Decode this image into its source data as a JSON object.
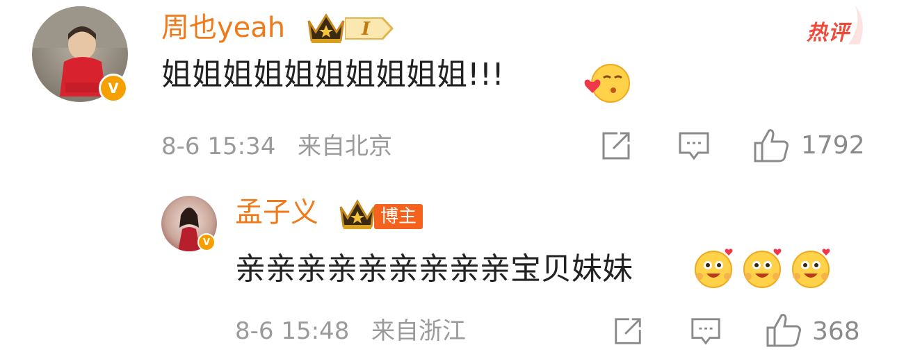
{
  "comment": {
    "username": "周也yeah",
    "level_badge": "I",
    "hot_label": "热评",
    "text": "姐姐姐姐姐姐姐姐姐姐!!!",
    "emoji": "kiss-heart-emoji",
    "timestamp": "8-6 15:34",
    "location": "来自北京",
    "like_count": "1792"
  },
  "reply": {
    "username": "孟子义",
    "tag": "博主",
    "text": "亲亲亲亲亲亲亲亲亲宝贝妹妹",
    "emojis": [
      "love-eyes-emoji",
      "love-eyes-emoji",
      "love-eyes-emoji"
    ],
    "timestamp": "8-6 15:48",
    "location": "来自浙江",
    "like_count": "368"
  },
  "colors": {
    "username": "#f07a1a",
    "hot_label": "#f04a3a",
    "verified_badge": "#f5a000",
    "tag_background": "#f5621d",
    "meta_text": "#9a9a9a"
  },
  "icons": [
    "verified-badge-icon",
    "crown-icon",
    "share-icon",
    "comment-icon",
    "like-icon"
  ]
}
